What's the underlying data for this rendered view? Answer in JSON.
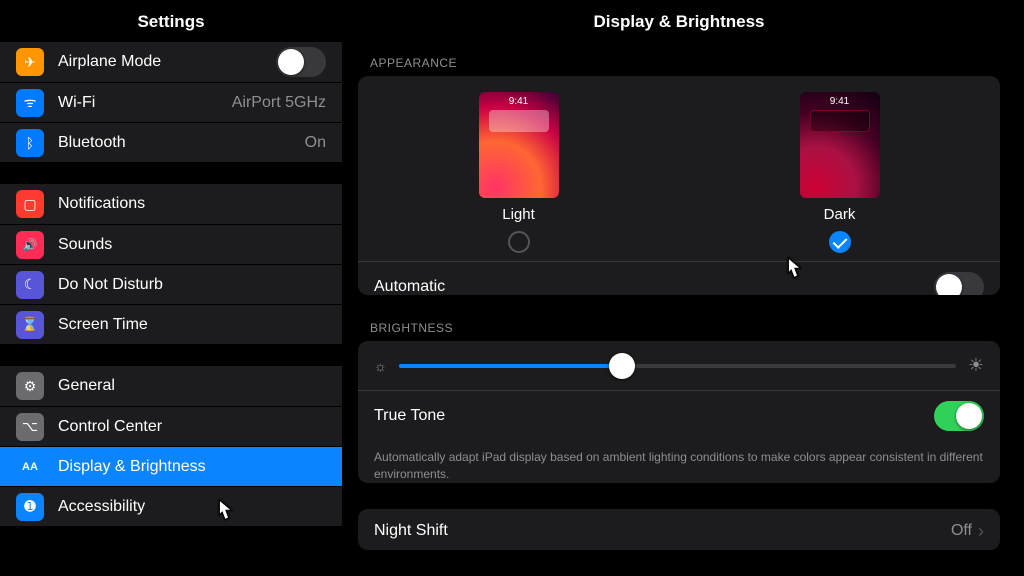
{
  "sidebar": {
    "title": "Settings",
    "items": [
      {
        "label": "Airplane Mode",
        "detail": "",
        "icon_glyph": "✈",
        "color": "bg-orange",
        "toggle": "off"
      },
      {
        "label": "Wi-Fi",
        "detail": "AirPort 5GHz",
        "icon_glyph": "ᯤ",
        "color": "bg-blue"
      },
      {
        "label": "Bluetooth",
        "detail": "On",
        "icon_glyph": "ᛒ",
        "color": "bg-blue"
      },
      {
        "label": "Notifications",
        "icon_glyph": "▢",
        "color": "bg-red"
      },
      {
        "label": "Sounds",
        "icon_glyph": "🔊",
        "color": "bg-pink"
      },
      {
        "label": "Do Not Disturb",
        "icon_glyph": "☾",
        "color": "bg-purple"
      },
      {
        "label": "Screen Time",
        "icon_glyph": "⌛",
        "color": "bg-purple"
      },
      {
        "label": "General",
        "icon_glyph": "⚙",
        "color": "bg-gray"
      },
      {
        "label": "Control Center",
        "icon_glyph": "⌥",
        "color": "bg-gray"
      },
      {
        "label": "Display & Brightness",
        "icon_glyph": "AA",
        "color": "bg-ltblue",
        "selected": true
      },
      {
        "label": "Accessibility",
        "icon_glyph": "➊",
        "color": "bg-ltblue"
      }
    ]
  },
  "detail": {
    "title": "Display & Brightness",
    "sections": {
      "appearance_header": "APPEARANCE",
      "light_label": "Light",
      "dark_label": "Dark",
      "preview_time": "9:41",
      "selected_theme": "dark",
      "automatic_label": "Automatic",
      "automatic_on": false,
      "brightness_header": "BRIGHTNESS",
      "brightness_value": 40,
      "true_tone_label": "True Tone",
      "true_tone_on": true,
      "true_tone_footnote": "Automatically adapt iPad display based on ambient lighting conditions to make colors appear consistent in different environments.",
      "night_shift_label": "Night Shift",
      "night_shift_value": "Off"
    }
  }
}
